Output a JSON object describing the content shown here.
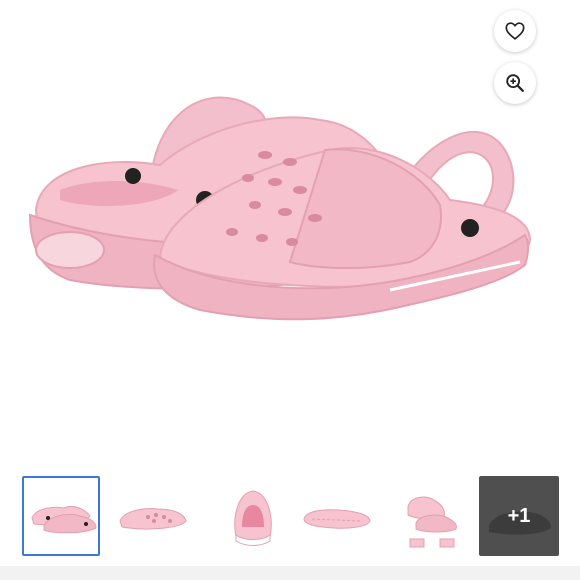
{
  "product_gallery": {
    "main_image": {
      "icon": "pink-clog-shoes-image"
    },
    "favorite_button": {
      "icon": "heart-icon"
    },
    "zoom_button": {
      "icon": "zoom-in-icon"
    },
    "thumbnails": [
      {
        "icon": "clogs-pair-side-thumbnail",
        "selected": true
      },
      {
        "icon": "clog-side-thumbnail",
        "selected": false
      },
      {
        "icon": "clog-back-thumbnail",
        "selected": false
      },
      {
        "icon": "clog-sole-thumbnail",
        "selected": false
      },
      {
        "icon": "clogs-size-views-thumbnail",
        "selected": false
      }
    ],
    "more_thumbnail": {
      "label": "+1",
      "icon": "clog-dark-thumbnail"
    }
  },
  "colors": {
    "shoe_pink": "#f2b8c6",
    "shoe_pink_light": "#f7ccd6",
    "shoe_pink_dark": "#e49fb1",
    "selected_border": "#3b78d8",
    "more_overlay": "#4f4f4f"
  }
}
